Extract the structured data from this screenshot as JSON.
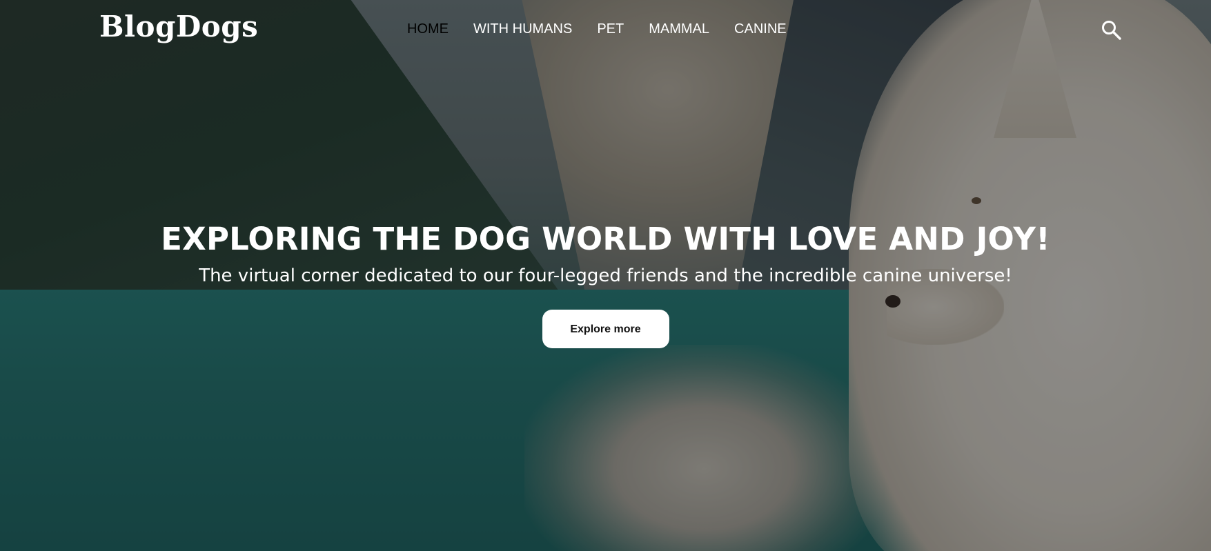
{
  "header": {
    "logo": "BlogDogs",
    "nav": [
      {
        "label": "HOME",
        "active": true
      },
      {
        "label": "WITH HUMANS",
        "active": false
      },
      {
        "label": "PET",
        "active": false
      },
      {
        "label": "MAMMAL",
        "active": false
      },
      {
        "label": "CANINE",
        "active": false
      }
    ],
    "search_icon": "search-icon"
  },
  "hero": {
    "title": "EXPLORING THE DOG WORLD WITH LOVE AND JOY!",
    "subtitle": "The virtual corner dedicated to our four-legged friends and the incredible canine universe!",
    "cta_label": "Explore more"
  },
  "colors": {
    "nav_active": "#000000",
    "text": "#ffffff",
    "button_bg": "#ffffff",
    "button_text": "#111111"
  }
}
